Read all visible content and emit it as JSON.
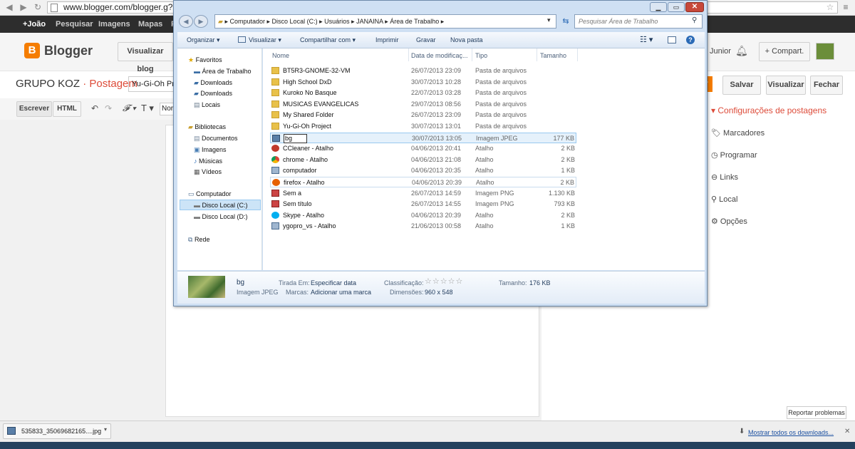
{
  "browser": {
    "url": "www.blogger.com/blogger.g?b"
  },
  "gbar": {
    "items": [
      "+João",
      "Pesquisar",
      "Imagens",
      "Mapas",
      "P"
    ]
  },
  "blogger": {
    "logo_text": "B",
    "brand": "Blogger",
    "view_blog": "Visualizar blog",
    "user": "Junior",
    "share": "+ Compart.",
    "blog_name": "GRUPO KOZ",
    "sep": "·",
    "section": "Postagem",
    "post_title": "Yu-Gi-Oh Pro",
    "publish": "r",
    "save": "Salvar",
    "preview": "Visualizar",
    "close": "Fechar",
    "compose": "Escrever",
    "html": "HTML",
    "font_btn": "Nor",
    "settings_title": "Configurações de postagens",
    "settings": [
      "Marcadores",
      "Programar",
      "Links",
      "Local",
      "Opções"
    ],
    "report": "Reportar problemas"
  },
  "explorer": {
    "breadcrumb": [
      "Computador",
      "Disco Local (C:)",
      "Usuários",
      "JANAINA",
      "Área de Trabalho"
    ],
    "search_placeholder": "Pesquisar Área de Trabalho",
    "commands": [
      "Organizar ▾",
      "Visualizar ▾",
      "Compartilhar com ▾",
      "Imprimir",
      "Gravar",
      "Nova pasta"
    ],
    "nav": {
      "favorites": "Favoritos",
      "fav_items": [
        "Área de Trabalho",
        "Downloads",
        "Downloads",
        "Locais"
      ],
      "libraries": "Bibliotecas",
      "lib_items": [
        "Documentos",
        "Imagens",
        "Músicas",
        "Vídeos"
      ],
      "computer": "Computador",
      "comp_items": [
        "Disco Local (C:)",
        "Disco Local (D:)"
      ],
      "network": "Rede"
    },
    "columns": [
      "Nome",
      "Data de modificaç...",
      "Tipo",
      "Tamanho"
    ],
    "files": [
      {
        "name": "BT5R3-GNOME-32-VM",
        "date": "26/07/2013 23:09",
        "type": "Pasta de arquivos",
        "size": "",
        "kind": "folder"
      },
      {
        "name": "High School DxD",
        "date": "30/07/2013 10:28",
        "type": "Pasta de arquivos",
        "size": "",
        "kind": "folder"
      },
      {
        "name": "Kuroko No Basque",
        "date": "22/07/2013 03:28",
        "type": "Pasta de arquivos",
        "size": "",
        "kind": "folder"
      },
      {
        "name": "MUSICAS EVANGELICAS",
        "date": "29/07/2013 08:56",
        "type": "Pasta de arquivos",
        "size": "",
        "kind": "folder"
      },
      {
        "name": "My Shared Folder",
        "date": "26/07/2013 23:09",
        "type": "Pasta de arquivos",
        "size": "",
        "kind": "folder"
      },
      {
        "name": "Yu-Gi-Oh Project",
        "date": "30/07/2013 13:01",
        "type": "Pasta de arquivos",
        "size": "",
        "kind": "folder"
      },
      {
        "name": "bg",
        "date": "30/07/2013 13:05",
        "type": "Imagem JPEG",
        "size": "177 KB",
        "kind": "image"
      },
      {
        "name": "CCleaner - Atalho",
        "date": "04/06/2013 20:41",
        "type": "Atalho",
        "size": "2 KB",
        "kind": "ccleaner"
      },
      {
        "name": "chrome - Atalho",
        "date": "04/06/2013 21:08",
        "type": "Atalho",
        "size": "2 KB",
        "kind": "chrome"
      },
      {
        "name": "computador",
        "date": "04/06/2013 20:35",
        "type": "Atalho",
        "size": "1 KB",
        "kind": "shortcut"
      },
      {
        "name": "firefox - Atalho",
        "date": "04/06/2013 20:39",
        "type": "Atalho",
        "size": "2 KB",
        "kind": "firefox"
      },
      {
        "name": "Sem a",
        "date": "26/07/2013 14:59",
        "type": "Imagem PNG",
        "size": "1.130 KB",
        "kind": "png"
      },
      {
        "name": "Sem título",
        "date": "26/07/2013 14:55",
        "type": "Imagem PNG",
        "size": "793 KB",
        "kind": "png"
      },
      {
        "name": "Skype - Atalho",
        "date": "04/06/2013 20:39",
        "type": "Atalho",
        "size": "2 KB",
        "kind": "skype"
      },
      {
        "name": "ygopro_vs - Atalho",
        "date": "21/06/2013 00:58",
        "type": "Atalho",
        "size": "1 KB",
        "kind": "shortcut"
      }
    ],
    "details": {
      "name": "bg",
      "type": "Imagem JPEG",
      "taken_label": "Tirada Em:",
      "taken": "Especificar data",
      "tags_label": "Marcas:",
      "tags": "Adicionar uma marca",
      "rating_label": "Classificação:",
      "rating": "☆☆☆☆☆",
      "dims_label": "Dimensões:",
      "dims": "960 x 548",
      "size_label": "Tamanho:",
      "size": "176 KB"
    }
  },
  "downloads": {
    "file": "535833_35069682165....jpg",
    "show_all": "Mostrar todos os downloads..."
  },
  "colors": {
    "blogger_orange": "#f57d00",
    "accent": "#dd4b39",
    "win_blue": "#cfe0f3"
  }
}
